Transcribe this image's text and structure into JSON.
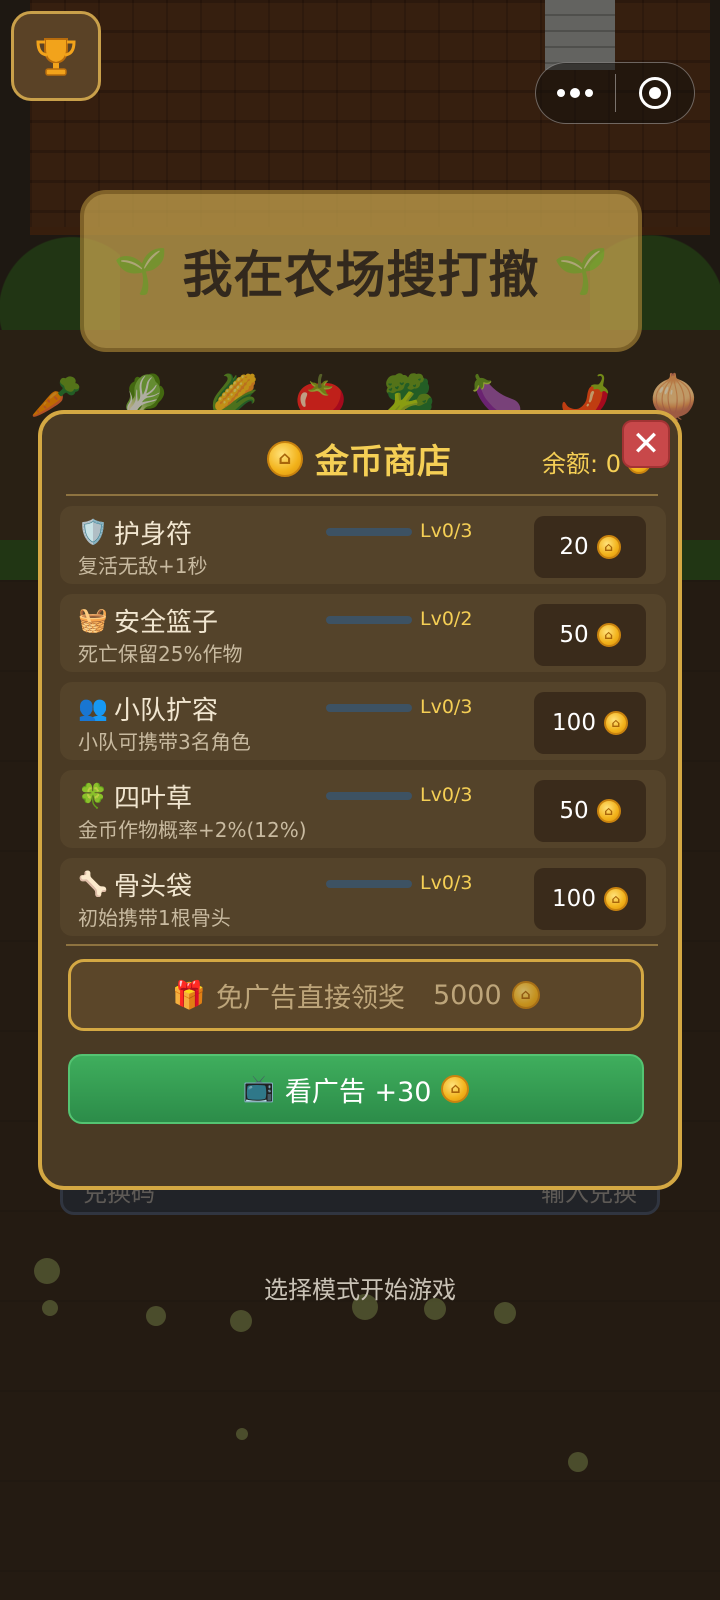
{
  "game": {
    "title": "我在农场搜打撤",
    "hint": "选择模式开始游戏",
    "behind_bar_left": "兑换码",
    "behind_bar_right": "输入兑换"
  },
  "vegetables": [
    "🥕",
    "🥬",
    "🌽",
    "🍅",
    "🥦",
    "🍆",
    "🌶️",
    "🧅"
  ],
  "top_bar": {
    "trophy_icon": "trophy-icon",
    "more_icon": "more-dots-icon",
    "close_icon": "target-circle-icon"
  },
  "shop": {
    "title": "金币商店",
    "balance_label": "余额: 0",
    "close_label": "✕",
    "items": [
      {
        "icon": "🛡️",
        "name": "护身符",
        "desc": "复活无敌+1秒",
        "level": "Lv0/3",
        "level_progress": 0,
        "price": "20"
      },
      {
        "icon": "🧺",
        "name": "安全篮子",
        "desc": "死亡保留25%作物",
        "level": "Lv0/2",
        "level_progress": 0,
        "price": "50"
      },
      {
        "icon": "👥",
        "name": "小队扩容",
        "desc": "小队可携带3名角色",
        "level": "Lv0/3",
        "level_progress": 0,
        "price": "100"
      },
      {
        "icon": "🍀",
        "name": "四叶草",
        "desc": "金币作物概率+2%(12%)",
        "level": "Lv0/3",
        "level_progress": 0,
        "price": "50"
      },
      {
        "icon": "🦴",
        "name": "骨头袋",
        "desc": "初始携带1根骨头",
        "level": "Lv0/3",
        "level_progress": 0,
        "price": "100"
      }
    ],
    "free_claim": {
      "icon": "🎁",
      "label": "免广告直接领奖",
      "amount": "5000"
    },
    "watch_ad": {
      "icon": "📺",
      "label": "看广告 +30"
    }
  },
  "colors": {
    "accent_gold": "#d4a843",
    "title_gold": "#f5cf55",
    "close_red": "#c8484a",
    "ad_green": "#3fae5d"
  }
}
